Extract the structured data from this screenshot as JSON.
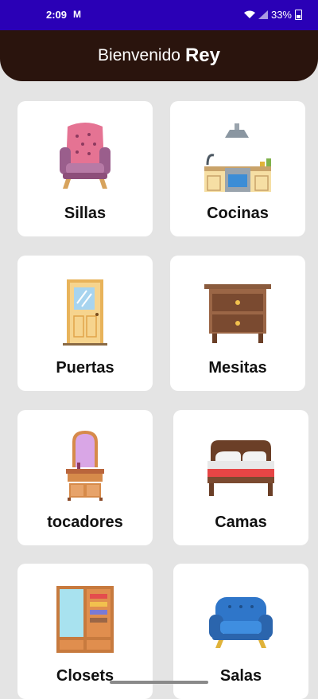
{
  "status_bar": {
    "time": "2:09",
    "mail": "M",
    "signal": "",
    "battery": "33%"
  },
  "header": {
    "welcome": "Bienvenido",
    "name": "Rey"
  },
  "categories": [
    {
      "label": "Sillas",
      "icon": "armchair-icon"
    },
    {
      "label": "Cocinas",
      "icon": "kitchen-icon"
    },
    {
      "label": "Puertas",
      "icon": "door-icon"
    },
    {
      "label": "Mesitas",
      "icon": "nightstand-icon"
    },
    {
      "label": "tocadores",
      "icon": "dresser-mirror-icon"
    },
    {
      "label": "Camas",
      "icon": "bed-icon"
    },
    {
      "label": "Closets",
      "icon": "wardrobe-icon"
    },
    {
      "label": "Salas",
      "icon": "sofa-icon"
    }
  ],
  "colors": {
    "status_bar": "#2a00b6",
    "header": "#2a140d",
    "background": "#e4e4e4"
  }
}
